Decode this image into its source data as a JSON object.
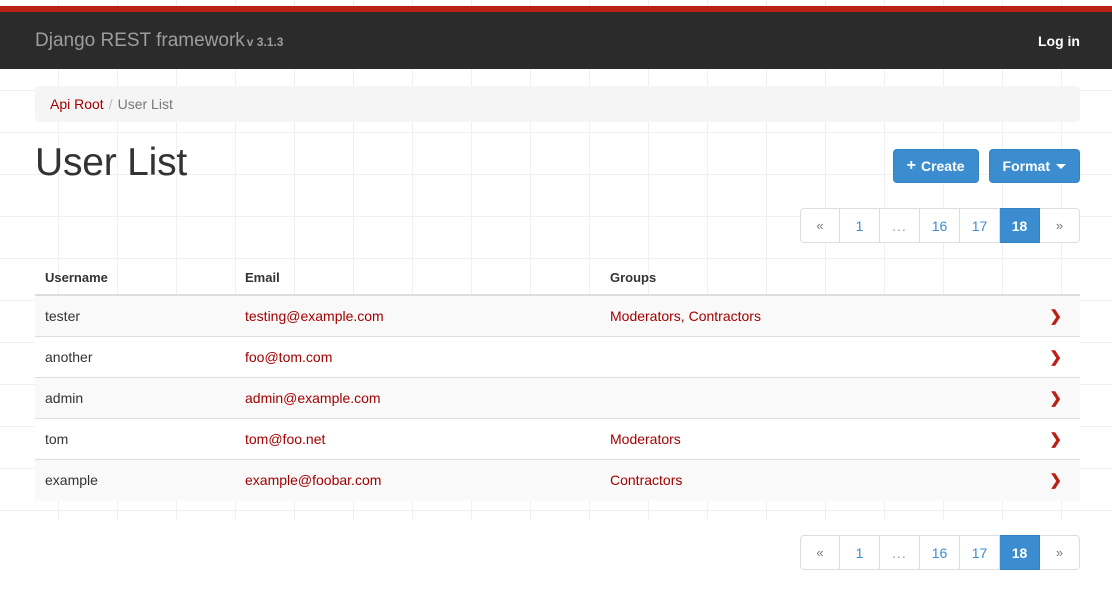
{
  "navbar": {
    "brand": "Django REST framework",
    "version": "v 3.1.3",
    "login_label": "Log in"
  },
  "breadcrumb": {
    "root_label": "Api Root",
    "separator": "/",
    "current_label": "User List"
  },
  "header": {
    "title": "User List",
    "create_label": "Create",
    "create_plus": "+",
    "format_label": "Format"
  },
  "pagination": {
    "prev": "«",
    "first": "1",
    "ellipsis": "...",
    "page_16": "16",
    "page_17": "17",
    "page_18": "18",
    "next": "»",
    "active_page": "18"
  },
  "table": {
    "columns": [
      "Username",
      "Email",
      "Groups"
    ],
    "rows": [
      {
        "username": "tester",
        "email": "testing@example.com",
        "groups": "Moderators, Contractors",
        "action_icon": "chevron-right-icon",
        "action_glyph": "❯"
      },
      {
        "username": "another",
        "email": "foo@tom.com",
        "groups": "",
        "action_icon": "chevron-right-icon",
        "action_glyph": "❯"
      },
      {
        "username": "admin",
        "email": "admin@example.com",
        "groups": "",
        "action_icon": "chevron-right-icon",
        "action_glyph": "❯"
      },
      {
        "username": "tom",
        "email": "tom@foo.net",
        "groups": "Moderators",
        "action_icon": "chevron-right-icon",
        "action_glyph": "❯"
      },
      {
        "username": "example",
        "email": "example@foobar.com",
        "groups": "Contractors",
        "action_icon": "chevron-right-icon",
        "action_glyph": "❯"
      }
    ]
  },
  "colors": {
    "brand_red": "#bb2014",
    "link_red": "#a30000",
    "navbar_bg": "#2b2b2b",
    "primary_blue": "#3b8dd0",
    "breadcrumb_bg": "#f5f5f5"
  }
}
